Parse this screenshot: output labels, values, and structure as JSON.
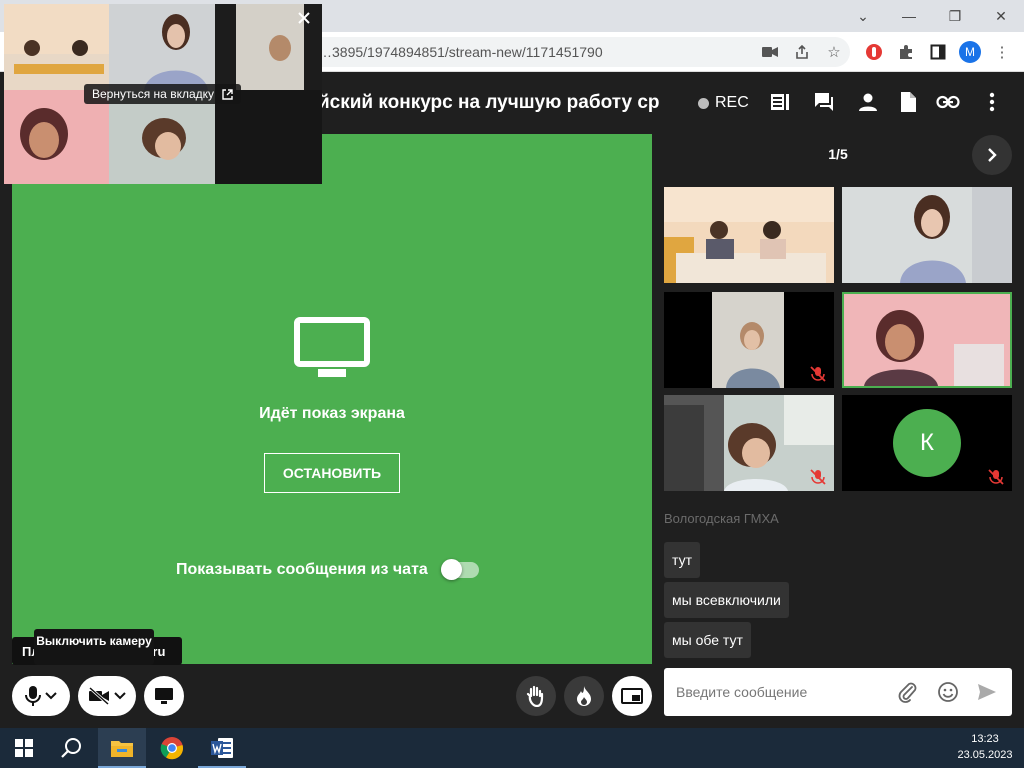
{
  "browser": {
    "url": "…3895/1974894851/stream-new/1171451790",
    "profile_initial": "M"
  },
  "header": {
    "title": "йский конкурс на лучшую работу ср",
    "rec_label": "REC"
  },
  "stage": {
    "share_text": "Идёт показ экрана",
    "stop_button": "ОСТАНОВИТЬ",
    "chat_toggle_label": "Показывать сообщения из чата",
    "chat_toggle_on": false,
    "platform_label": "Платформа webinar.ru",
    "camera_tooltip": "Выключить камеру"
  },
  "pip": {
    "return_label": "Вернуться на вкладку"
  },
  "participants": {
    "pager": "1/5",
    "avatar_letter": "К"
  },
  "chat": {
    "sender": "Вологодская ГМХА",
    "messages": [
      "тут",
      "мы всевключили",
      "мы обе тут"
    ],
    "input_placeholder": "Введите сообщение"
  },
  "taskbar": {
    "time": "13:23",
    "date": "23.05.2023"
  },
  "colors": {
    "accent_green": "#4caf50",
    "background": "#1f1f1f",
    "taskbar": "#1b2a3a"
  }
}
